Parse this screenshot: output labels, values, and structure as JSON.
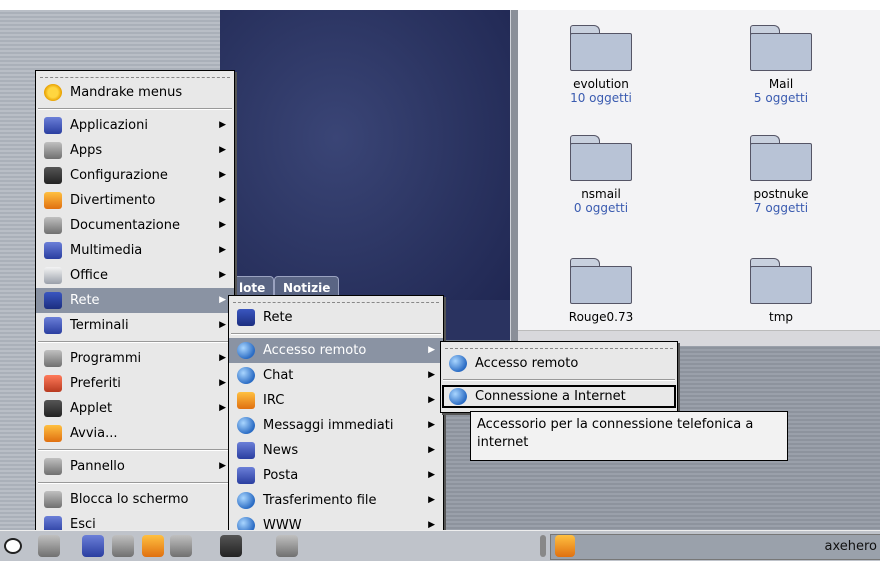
{
  "start_menu": {
    "header": "Mandrake menus",
    "items": [
      {
        "label": "Applicazioni",
        "icon": "applications-icon",
        "submenu": true
      },
      {
        "label": "Apps",
        "icon": "apps-icon",
        "submenu": true
      },
      {
        "label": "Configurazione",
        "icon": "configuration-icon",
        "submenu": true
      },
      {
        "label": "Divertimento",
        "icon": "games-icon",
        "submenu": true
      },
      {
        "label": "Documentazione",
        "icon": "documentation-icon",
        "submenu": true
      },
      {
        "label": "Multimedia",
        "icon": "multimedia-icon",
        "submenu": true
      },
      {
        "label": "Office",
        "icon": "office-icon",
        "submenu": true
      },
      {
        "label": "Rete",
        "icon": "network-icon",
        "submenu": true,
        "highlighted": true
      },
      {
        "label": "Terminali",
        "icon": "terminal-icon",
        "submenu": true
      }
    ],
    "items2": [
      {
        "label": "Programmi",
        "icon": "programs-icon",
        "submenu": true
      },
      {
        "label": "Preferiti",
        "icon": "favorites-icon",
        "submenu": true
      },
      {
        "label": "Applet",
        "icon": "applet-icon",
        "submenu": true
      },
      {
        "label": "Avvia...",
        "icon": "run-icon",
        "submenu": false
      }
    ],
    "items3": [
      {
        "label": "Pannello",
        "icon": "panel-icon",
        "submenu": true
      }
    ],
    "items4": [
      {
        "label": "Blocca lo schermo",
        "icon": "lock-screen-icon",
        "submenu": false
      },
      {
        "label": "Esci",
        "icon": "logout-icon",
        "submenu": false
      }
    ]
  },
  "rete_menu": {
    "header": "Rete",
    "items": [
      {
        "label": "Accesso remoto",
        "submenu": true,
        "highlighted": true
      },
      {
        "label": "Chat",
        "submenu": true
      },
      {
        "label": "IRC",
        "submenu": true
      },
      {
        "label": "Messaggi immediati",
        "submenu": true
      },
      {
        "label": "News",
        "submenu": true
      },
      {
        "label": "Posta",
        "submenu": true
      },
      {
        "label": "Trasferimento file",
        "submenu": true
      },
      {
        "label": "WWW",
        "submenu": true
      }
    ]
  },
  "remote_menu": {
    "header": "Accesso remoto",
    "items": [
      {
        "label": "Connessione a Internet",
        "selected": true
      }
    ]
  },
  "tooltip": {
    "text_line1": "Accessorio per la connessione telefonica a",
    "text_line2": "internet"
  },
  "background_tabs": {
    "tab1": "lote",
    "tab2": "Notizie"
  },
  "file_manager": {
    "files": [
      {
        "name": "evolution",
        "count": "10 oggetti"
      },
      {
        "name": "Mail",
        "count": "5 oggetti"
      },
      {
        "name": "nsmail",
        "count": "0 oggetti"
      },
      {
        "name": "postnuke",
        "count": "7 oggetti"
      },
      {
        "name": "Rouge0.73",
        "count": ""
      },
      {
        "name": "tmp",
        "count": ""
      }
    ]
  },
  "taskbar": {
    "task_label": "axehero"
  }
}
